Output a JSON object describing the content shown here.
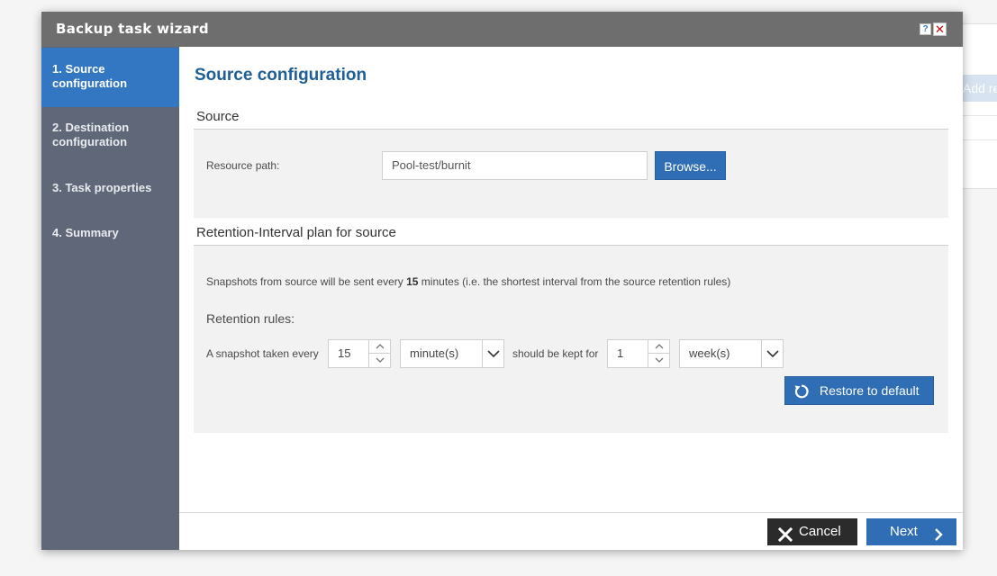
{
  "background": {
    "partial_button_label": "Add re"
  },
  "dialog": {
    "title": "Backup task wizard",
    "help_label": "?",
    "close_label": "✕"
  },
  "sidebar": {
    "steps": [
      {
        "label": "1. Source configuration",
        "active": true
      },
      {
        "label": "2. Destination configuration",
        "active": false
      },
      {
        "label": "3. Task properties",
        "active": false
      },
      {
        "label": "4. Summary",
        "active": false
      }
    ]
  },
  "main": {
    "page_title": "Source configuration",
    "source_section": {
      "title": "Source",
      "resource_path_label": "Resource path:",
      "resource_path_value": "Pool-test/burnit",
      "browse_label": "Browse..."
    },
    "retention_section": {
      "title": "Retention-Interval plan for source",
      "interval_prefix": "Snapshots from source will be sent every ",
      "interval_value": "15",
      "interval_suffix": " minutes (i.e. the shortest interval from the source retention rules)",
      "retention_rules_label": "Retention rules:",
      "snapshot_every_label": "A snapshot taken every",
      "interval_number": "15",
      "interval_unit": "minute(s)",
      "kept_for_label": "should be kept for",
      "keep_number": "1",
      "keep_unit": "week(s)",
      "restore_label": "Restore to default"
    }
  },
  "footer": {
    "cancel_label": "Cancel",
    "next_label": "Next"
  },
  "colors": {
    "titlebar": "#6e6e6e",
    "sidebar": "#5f6778",
    "active_step": "#3376c2",
    "primary_button": "#2f6db5",
    "cancel_button": "#2b2b2b",
    "page_title": "#1f5f97"
  },
  "icons": {
    "restore": "refresh-icon",
    "cancel": "close-icon",
    "next": "chevron-right-icon",
    "spinner_up": "chevron-up-icon",
    "spinner_down": "chevron-down-icon",
    "select_caret": "chevron-down-icon"
  }
}
